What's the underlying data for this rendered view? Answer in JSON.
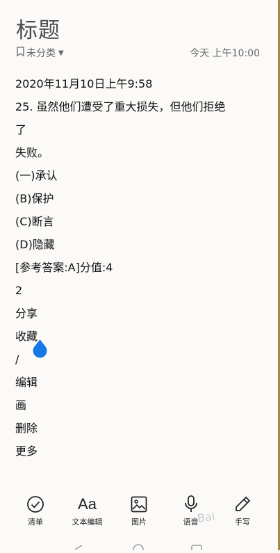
{
  "note": {
    "title": "标题",
    "category": "未分类",
    "timestamp": "今天 上午10:00",
    "lines": [
      "2020年11月10日上午9:58",
      "25. 虽然他们遭受了重大损失，但他们拒绝",
      "了",
      "失败。",
      "(一)承认",
      "(B)保护",
      "(C)断言",
      "(D)隐藏",
      "[参考答案:A]分值:4",
      "2",
      "分享",
      "收藏",
      "/",
      "编辑",
      "画",
      "删除",
      "更多"
    ]
  },
  "toolbar": {
    "checklist": "清单",
    "text_edit": "文本编辑",
    "image": "图片",
    "voice": "语音",
    "handwrite": "手写"
  },
  "watermark": "Bai",
  "colors": {
    "accent": "#1677e6",
    "border": "#9f8a4c"
  }
}
